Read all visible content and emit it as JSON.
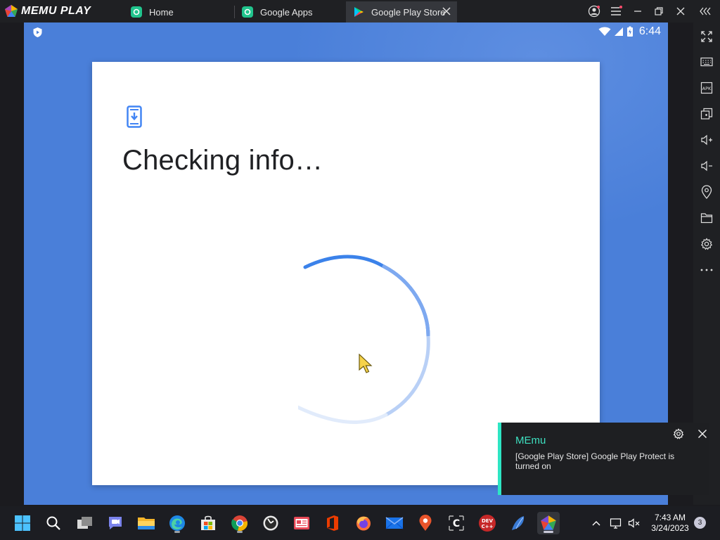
{
  "app": {
    "brand": "MEMU PLAY"
  },
  "tabs": [
    {
      "label": "Home",
      "icon": "memu-app-icon",
      "active": false
    },
    {
      "label": "Google Apps",
      "icon": "memu-app-icon",
      "active": false
    },
    {
      "label": "Google Play Store",
      "icon": "play-store-icon",
      "active": true
    }
  ],
  "android": {
    "status_time": "6:44",
    "dialog": {
      "icon": "phone-download-icon",
      "title": "Checking info…"
    }
  },
  "notification": {
    "app_name": "MEmu",
    "message": "[Google Play Store] Google Play Protect is turned on"
  },
  "sidebar": [
    "fullscreen-icon",
    "keyboard-icon",
    "apk-icon",
    "multi-instance-icon",
    "volume-up-icon",
    "volume-down-icon",
    "location-icon",
    "folder-icon",
    "settings-icon",
    "more-icon"
  ],
  "taskbar": {
    "time": "7:43 AM",
    "date": "3/24/2023",
    "notification_count": "3",
    "apps": [
      "start-icon",
      "search-icon",
      "task-view-icon",
      "teams-chat-icon",
      "file-explorer-icon",
      "edge-icon",
      "store-icon",
      "chrome-icon",
      "clock-app-icon",
      "news-icon",
      "office-icon",
      "firefox-icon",
      "mail-icon",
      "maps-pin-icon",
      "code-app-icon",
      "dev-cpp-icon",
      "feather-app-icon",
      "memu-icon"
    ]
  },
  "colors": {
    "android_bg": "#4a7fd9",
    "accent_blue": "#4285f4",
    "toast_accent": "#2ee6c4"
  }
}
